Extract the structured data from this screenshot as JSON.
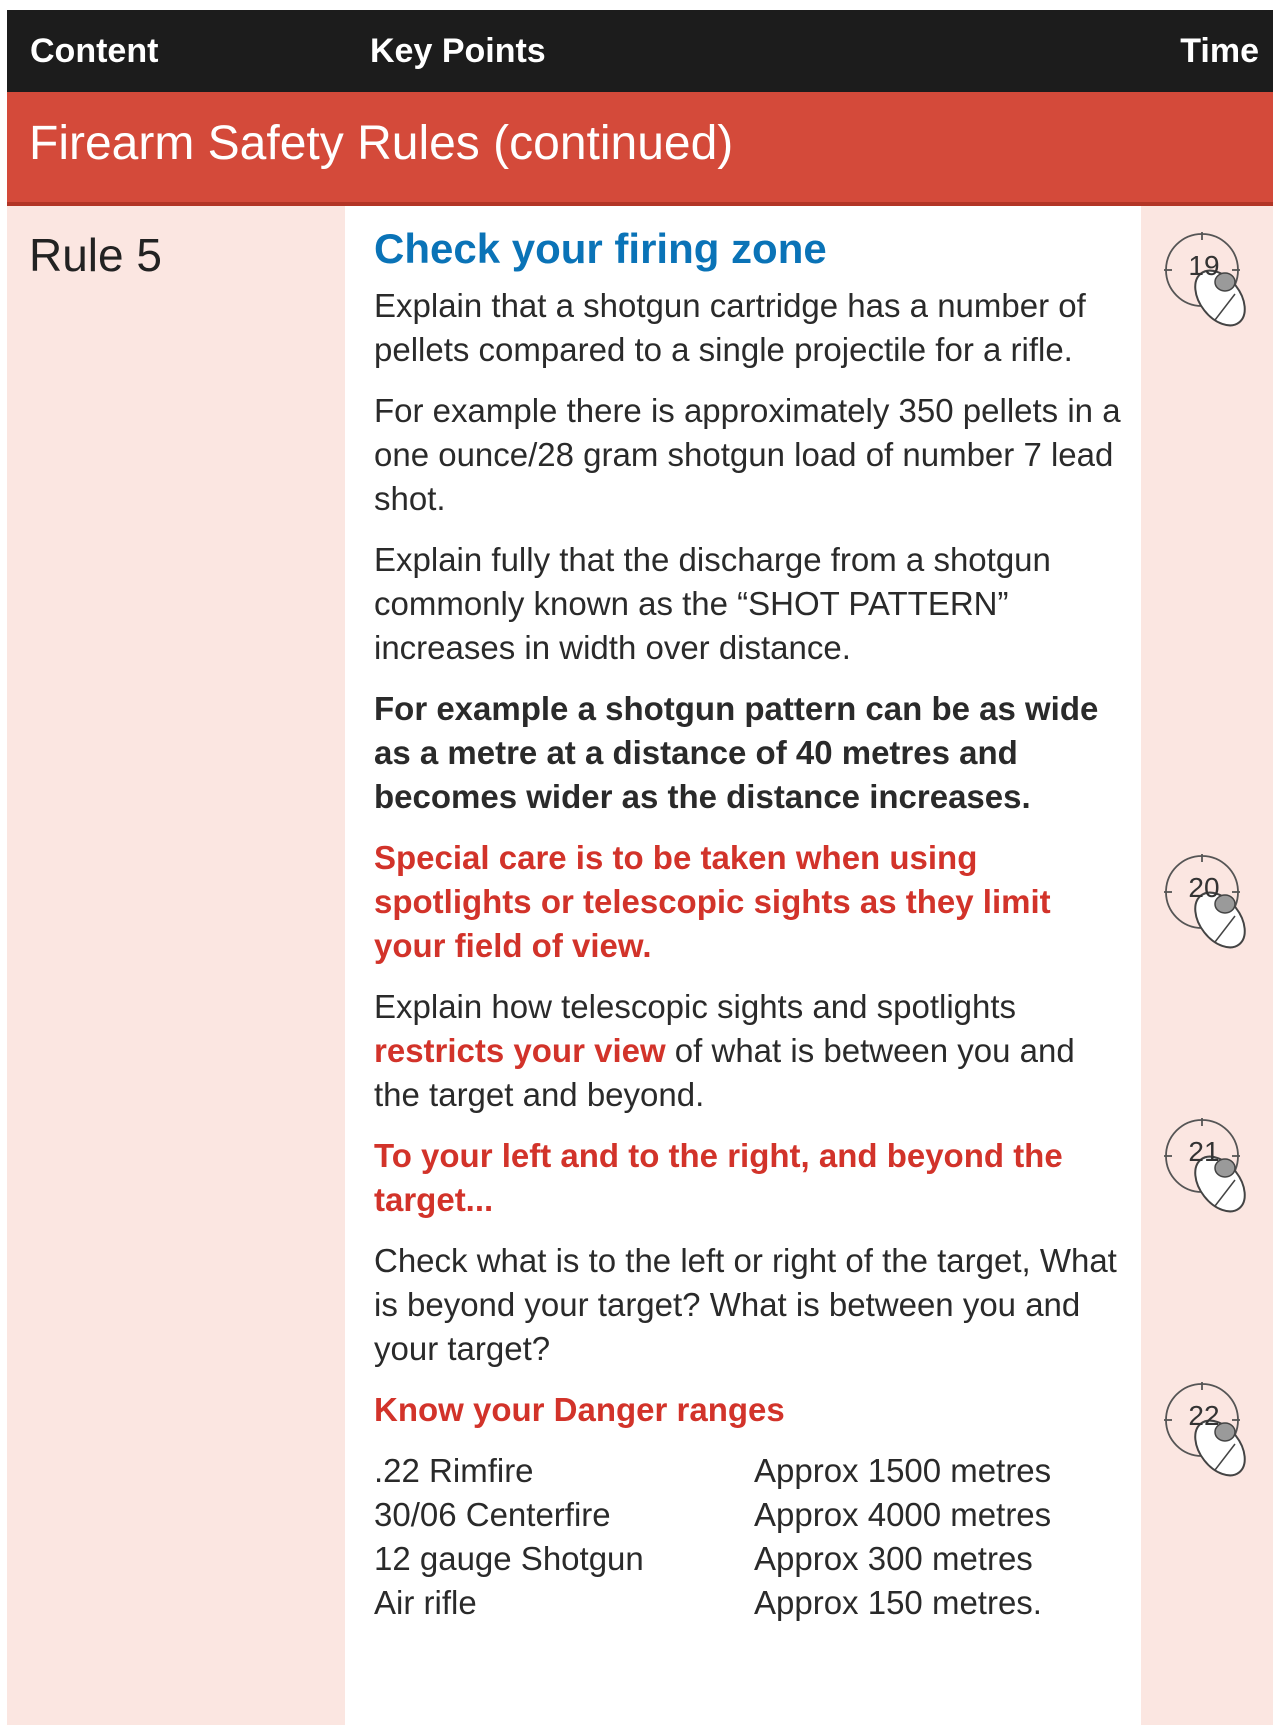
{
  "header": {
    "content": "Content",
    "key_points": "Key Points",
    "time": "Time"
  },
  "section": {
    "title": "Firearm Safety Rules (continued)"
  },
  "rule": {
    "label": "Rule 5",
    "heading": "Check your firing zone",
    "para1": "Explain that a shotgun cartridge has a number of pellets compared to a single projectile for a rifle.",
    "para2": "For example there is approximately 350 pellets in a one ounce/28 gram shotgun load of number 7 lead shot.",
    "para3": "Explain fully that the discharge from a shotgun commonly known as the “SHOT PATTERN” increases in width over distance.",
    "para4": "For example a shotgun pattern can be as wide as a metre at a distance of 40 metres and becomes wider as the distance increases.",
    "para5": "Special care is to be taken when using spotlights or telescopic sights as they limit your field of view.",
    "para6_pre": "Explain how telescopic sights and spotlights ",
    "para6_em": "restricts your view",
    "para6_post": " of what is between you and the target and beyond.",
    "para7": "To your left and to the right, and beyond the target...",
    "para8": "Check what is to the left or right of the target, What is beyond your target? What is between you and your target?",
    "danger_heading": "Know your Danger ranges",
    "ranges": [
      {
        "weapon": ".22 Rimfire",
        "distance": "Approx 1500 metres"
      },
      {
        "weapon": "30/06 Centerfire",
        "distance": "Approx 4000 metres"
      },
      {
        "weapon": "12 gauge Shotgun",
        "distance": "Approx 300 metres"
      },
      {
        "weapon": "Air rifle",
        "distance": "Approx 150 metres."
      }
    ]
  },
  "time_markers": [
    "19",
    "20",
    "21",
    "22"
  ],
  "icons": {
    "time_marker": "clock-mouse-icon"
  },
  "colors": {
    "header_bg": "#1c1c1c",
    "section_bg": "#d44a3a",
    "side_bg": "#fbe6e1",
    "heading_blue": "#0a73b7",
    "emphasis_red": "#d2332a"
  }
}
